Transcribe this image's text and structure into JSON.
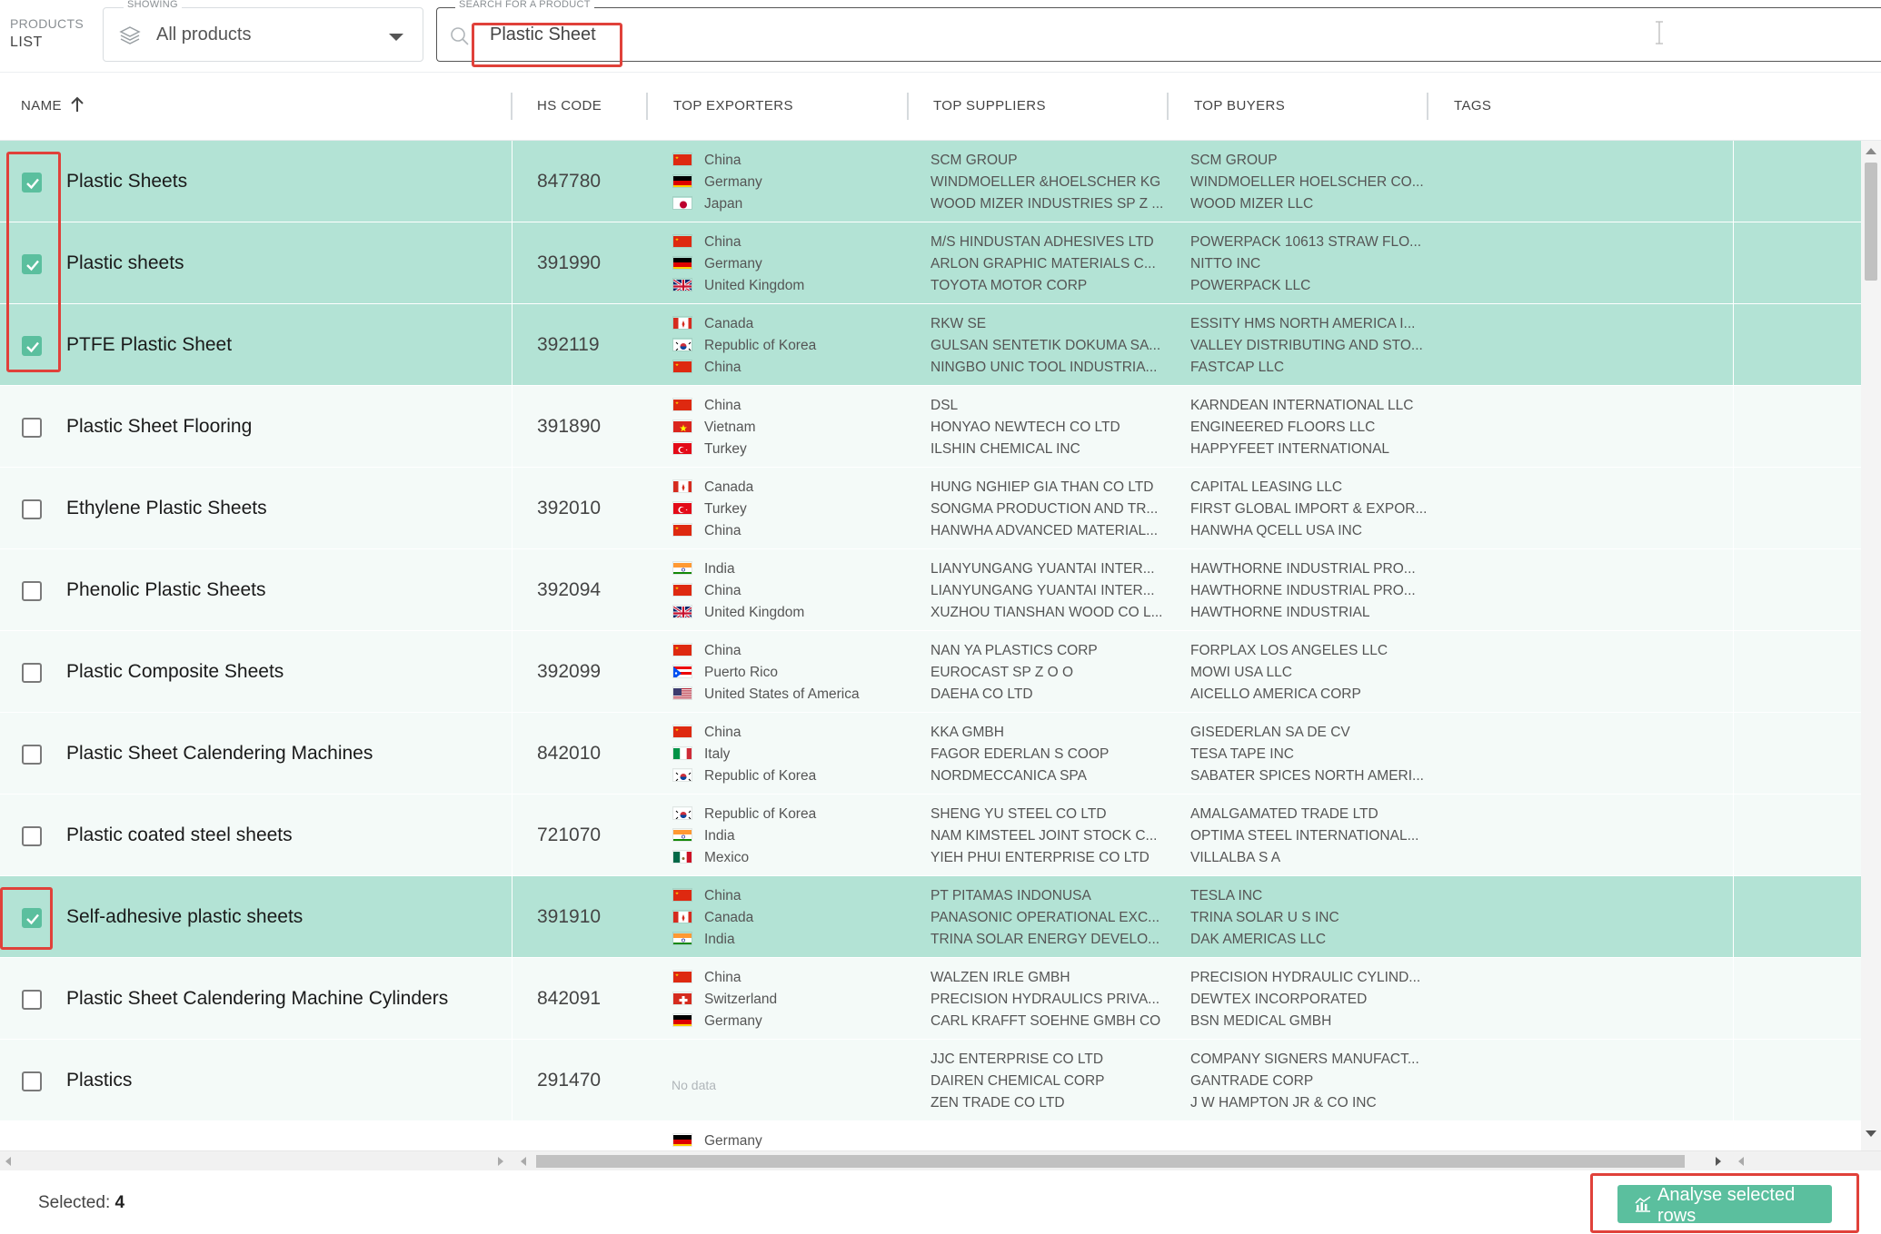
{
  "header": {
    "products_small": "PRODUCTS",
    "products_big": "LIST",
    "showing_label": "SHOWING",
    "showing_value": "All products",
    "search_label": "SEARCH FOR A PRODUCT",
    "search_value": "Plastic Sheet"
  },
  "columns": {
    "name": "NAME",
    "hs_code": "HS CODE",
    "top_exporters": "TOP EXPORTERS",
    "top_suppliers": "TOP SUPPLIERS",
    "top_buyers": "TOP BUYERS",
    "tags": "TAGS"
  },
  "rows": [
    {
      "name": "Plastic Sheets",
      "hs": "847780",
      "checked": true,
      "exporters": [
        {
          "country": "China",
          "flag": "cn"
        },
        {
          "country": "Germany",
          "flag": "de"
        },
        {
          "country": "Japan",
          "flag": "jp"
        }
      ],
      "suppliers": [
        "SCM GROUP",
        "WINDMOELLER &HOELSCHER KG",
        "WOOD MIZER INDUSTRIES SP Z ..."
      ],
      "buyers": [
        "SCM GROUP",
        "WINDMOELLER HOELSCHER CO...",
        "WOOD MIZER LLC"
      ]
    },
    {
      "name": "Plastic sheets",
      "hs": "391990",
      "checked": true,
      "exporters": [
        {
          "country": "China",
          "flag": "cn"
        },
        {
          "country": "Germany",
          "flag": "de"
        },
        {
          "country": "United Kingdom",
          "flag": "gb"
        }
      ],
      "suppliers": [
        "M/S HINDUSTAN ADHESIVES LTD",
        "ARLON GRAPHIC MATERIALS C...",
        "TOYOTA MOTOR CORP"
      ],
      "buyers": [
        "POWERPACK 10613 STRAW FLO...",
        "NITTO INC",
        "POWERPACK LLC"
      ]
    },
    {
      "name": "PTFE Plastic Sheet",
      "hs": "392119",
      "checked": true,
      "exporters": [
        {
          "country": "Canada",
          "flag": "ca"
        },
        {
          "country": "Republic of Korea",
          "flag": "kr"
        },
        {
          "country": "China",
          "flag": "cn"
        }
      ],
      "suppliers": [
        "RKW SE",
        "GULSAN SENTETIK DOKUMA SA...",
        "NINGBO UNIC TOOL INDUSTRIA..."
      ],
      "buyers": [
        "ESSITY HMS NORTH AMERICA I...",
        "VALLEY DISTRIBUTING AND STO...",
        "FASTCAP LLC"
      ]
    },
    {
      "name": "Plastic Sheet Flooring",
      "hs": "391890",
      "checked": false,
      "exporters": [
        {
          "country": "China",
          "flag": "cn"
        },
        {
          "country": "Vietnam",
          "flag": "vn"
        },
        {
          "country": "Turkey",
          "flag": "tr"
        }
      ],
      "suppliers": [
        "DSL",
        "HONYAO NEWTECH CO LTD",
        "ILSHIN CHEMICAL INC"
      ],
      "buyers": [
        "KARNDEAN INTERNATIONAL LLC",
        "ENGINEERED FLOORS LLC",
        "HAPPYFEET INTERNATIONAL"
      ]
    },
    {
      "name": "Ethylene Plastic Sheets",
      "hs": "392010",
      "checked": false,
      "exporters": [
        {
          "country": "Canada",
          "flag": "ca"
        },
        {
          "country": "Turkey",
          "flag": "tr"
        },
        {
          "country": "China",
          "flag": "cn"
        }
      ],
      "suppliers": [
        "HUNG NGHIEP GIA THAN CO LTD",
        "SONGMA PRODUCTION AND TR...",
        "HANWHA ADVANCED MATERIAL..."
      ],
      "buyers": [
        "CAPITAL LEASING LLC",
        "FIRST GLOBAL IMPORT & EXPOR...",
        "HANWHA QCELL USA INC"
      ]
    },
    {
      "name": "Phenolic Plastic Sheets",
      "hs": "392094",
      "checked": false,
      "exporters": [
        {
          "country": "India",
          "flag": "in"
        },
        {
          "country": "China",
          "flag": "cn"
        },
        {
          "country": "United Kingdom",
          "flag": "gb"
        }
      ],
      "suppliers": [
        "LIANYUNGANG YUANTAI INTER...",
        "LIANYUNGANG YUANTAI INTER...",
        "XUZHOU TIANSHAN WOOD CO L..."
      ],
      "buyers": [
        "HAWTHORNE INDUSTRIAL PRO...",
        "HAWTHORNE INDUSTRIAL PRO...",
        "HAWTHORNE INDUSTRIAL"
      ]
    },
    {
      "name": "Plastic Composite Sheets",
      "hs": "392099",
      "checked": false,
      "exporters": [
        {
          "country": "China",
          "flag": "cn"
        },
        {
          "country": "Puerto Rico",
          "flag": "pr"
        },
        {
          "country": "United States of America",
          "flag": "us"
        }
      ],
      "suppliers": [
        "NAN YA PLASTICS CORP",
        "EUROCAST SP Z O O",
        "DAEHA CO LTD"
      ],
      "buyers": [
        "FORPLAX LOS ANGELES LLC",
        "MOWI USA LLC",
        "AICELLO AMERICA CORP"
      ]
    },
    {
      "name": "Plastic Sheet Calendering Machines",
      "hs": "842010",
      "checked": false,
      "exporters": [
        {
          "country": "China",
          "flag": "cn"
        },
        {
          "country": "Italy",
          "flag": "it"
        },
        {
          "country": "Republic of Korea",
          "flag": "kr"
        }
      ],
      "suppliers": [
        "KKA GMBH",
        "FAGOR EDERLAN S COOP",
        "NORDMECCANICA SPA"
      ],
      "buyers": [
        "GISEDERLAN SA DE CV",
        "TESA TAPE INC",
        "SABATER SPICES NORTH AMERI..."
      ]
    },
    {
      "name": "Plastic coated steel sheets",
      "hs": "721070",
      "checked": false,
      "exporters": [
        {
          "country": "Republic of Korea",
          "flag": "kr"
        },
        {
          "country": "India",
          "flag": "in"
        },
        {
          "country": "Mexico",
          "flag": "mx"
        }
      ],
      "suppliers": [
        "SHENG YU STEEL CO LTD",
        "NAM KIMSTEEL JOINT STOCK C...",
        "YIEH PHUI ENTERPRISE CO LTD"
      ],
      "buyers": [
        "AMALGAMATED TRADE LTD",
        "OPTIMA STEEL INTERNATIONAL...",
        "VILLALBA S A"
      ]
    },
    {
      "name": "Self-adhesive plastic sheets",
      "hs": "391910",
      "checked": true,
      "exporters": [
        {
          "country": "China",
          "flag": "cn"
        },
        {
          "country": "Canada",
          "flag": "ca"
        },
        {
          "country": "India",
          "flag": "in"
        }
      ],
      "suppliers": [
        "PT PITAMAS INDONUSA",
        "PANASONIC OPERATIONAL EXC...",
        "TRINA SOLAR ENERGY DEVELO..."
      ],
      "buyers": [
        "TESLA INC",
        "TRINA SOLAR U S INC",
        "DAK AMERICAS LLC"
      ]
    },
    {
      "name": "Plastic Sheet Calendering Machine Cylinders",
      "hs": "842091",
      "checked": false,
      "exporters": [
        {
          "country": "China",
          "flag": "cn"
        },
        {
          "country": "Switzerland",
          "flag": "ch"
        },
        {
          "country": "Germany",
          "flag": "de"
        }
      ],
      "suppliers": [
        "WALZEN IRLE GMBH",
        "PRECISION HYDRAULICS PRIVA...",
        "CARL KRAFFT SOEHNE GMBH CO"
      ],
      "buyers": [
        "PRECISION HYDRAULIC CYLIND...",
        "DEWTEX INCORPORATED",
        "BSN MEDICAL GMBH"
      ]
    },
    {
      "name": "Plastics",
      "hs": "291470",
      "checked": false,
      "no_data": "No data",
      "exporters": [],
      "suppliers": [
        "JJC ENTERPRISE CO LTD",
        "DAIREN CHEMICAL CORP",
        "ZEN TRADE CO LTD"
      ],
      "buyers": [
        "COMPANY SIGNERS MANUFACT...",
        "GANTRADE CORP",
        "J W HAMPTON JR & CO INC"
      ]
    },
    {
      "name": "",
      "hs": "",
      "checked": null,
      "partial": true,
      "exporters": [
        {
          "country": "Germany",
          "flag": "de"
        }
      ],
      "suppliers": [],
      "buyers": []
    }
  ],
  "footer": {
    "selected_label": "Selected:",
    "selected_count": "4",
    "analyse_label": "Analyse selected rows"
  },
  "colors": {
    "selected_row": "#b3e3d5",
    "accent": "#5bbf9e",
    "highlight": "#e0413a"
  },
  "icons": {
    "showing": "layers-icon",
    "search": "search-icon",
    "sort": "arrow-up-icon",
    "analyse": "chart-icon"
  }
}
